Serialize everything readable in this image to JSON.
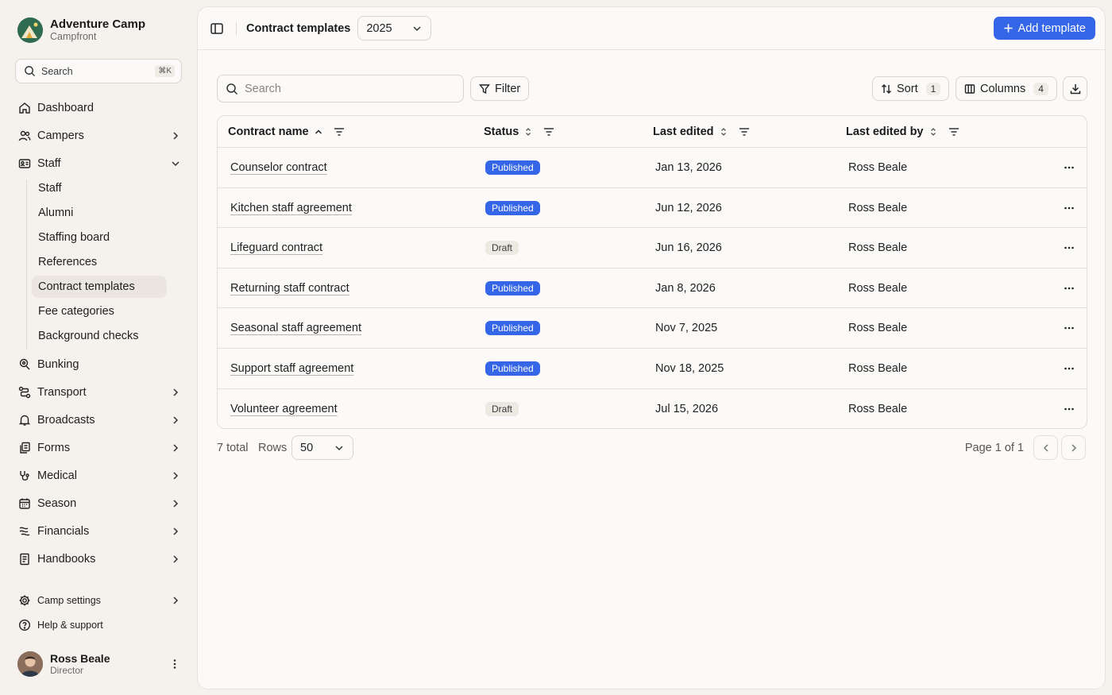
{
  "org": {
    "name": "Adventure Camp",
    "subtitle": "Campfront"
  },
  "sidebar": {
    "search_placeholder": "Search",
    "search_shortcut": "⌘K",
    "nav": [
      {
        "label": "Dashboard",
        "icon": "home-icon",
        "has_chevron": false
      },
      {
        "label": "Campers",
        "icon": "users-icon",
        "has_chevron": true
      },
      {
        "label": "Staff",
        "icon": "id-card-icon",
        "has_chevron": true,
        "expanded": true
      },
      {
        "label": "Bunking",
        "icon": "bunk-icon",
        "has_chevron": false
      },
      {
        "label": "Transport",
        "icon": "route-icon",
        "has_chevron": true
      },
      {
        "label": "Broadcasts",
        "icon": "bell-icon",
        "has_chevron": true
      },
      {
        "label": "Forms",
        "icon": "forms-icon",
        "has_chevron": true
      },
      {
        "label": "Medical",
        "icon": "stethoscope-icon",
        "has_chevron": true
      },
      {
        "label": "Season",
        "icon": "calendar-icon",
        "has_chevron": true
      },
      {
        "label": "Financials",
        "icon": "coins-icon",
        "has_chevron": true
      },
      {
        "label": "Handbooks",
        "icon": "book-icon",
        "has_chevron": true
      }
    ],
    "staff_sub": [
      "Staff",
      "Alumni",
      "Staffing board",
      "References",
      "Contract templates",
      "Fee categories",
      "Background checks"
    ],
    "active_sub": "Contract templates",
    "bottom": [
      {
        "label": "Camp settings",
        "icon": "gear-icon"
      },
      {
        "label": "Help & support",
        "icon": "help-icon"
      }
    ],
    "user": {
      "name": "Ross Beale",
      "role": "Director"
    }
  },
  "topbar": {
    "title": "Contract templates",
    "year": "2025",
    "add_label": "Add template"
  },
  "toolbar": {
    "search_placeholder": "Search",
    "filter_label": "Filter",
    "sort_label": "Sort",
    "sort_count": "1",
    "columns_label": "Columns",
    "columns_count": "4"
  },
  "table": {
    "headers": [
      "Contract name",
      "Status",
      "Last edited",
      "Last edited by"
    ],
    "rows": [
      {
        "name": "Counselor contract",
        "status": "Published",
        "edited": "Jan 13, 2026",
        "by": "Ross Beale"
      },
      {
        "name": "Kitchen staff agreement",
        "status": "Published",
        "edited": "Jun 12, 2026",
        "by": "Ross Beale"
      },
      {
        "name": "Lifeguard contract",
        "status": "Draft",
        "edited": "Jun 16, 2026",
        "by": "Ross Beale"
      },
      {
        "name": "Returning staff contract",
        "status": "Published",
        "edited": "Jan 8, 2026",
        "by": "Ross Beale"
      },
      {
        "name": "Seasonal staff agreement",
        "status": "Published",
        "edited": "Nov 7, 2025",
        "by": "Ross Beale"
      },
      {
        "name": "Support staff agreement",
        "status": "Published",
        "edited": "Nov 18, 2025",
        "by": "Ross Beale"
      },
      {
        "name": "Volunteer agreement",
        "status": "Draft",
        "edited": "Jul 15, 2026",
        "by": "Ross Beale"
      }
    ]
  },
  "footer": {
    "total": "7 total",
    "rows_label": "Rows",
    "rows_value": "50",
    "page_label": "Page 1 of 1"
  },
  "colors": {
    "accent": "#3566e8",
    "background": "#f5f2ed",
    "panel": "#fbfaf8"
  }
}
